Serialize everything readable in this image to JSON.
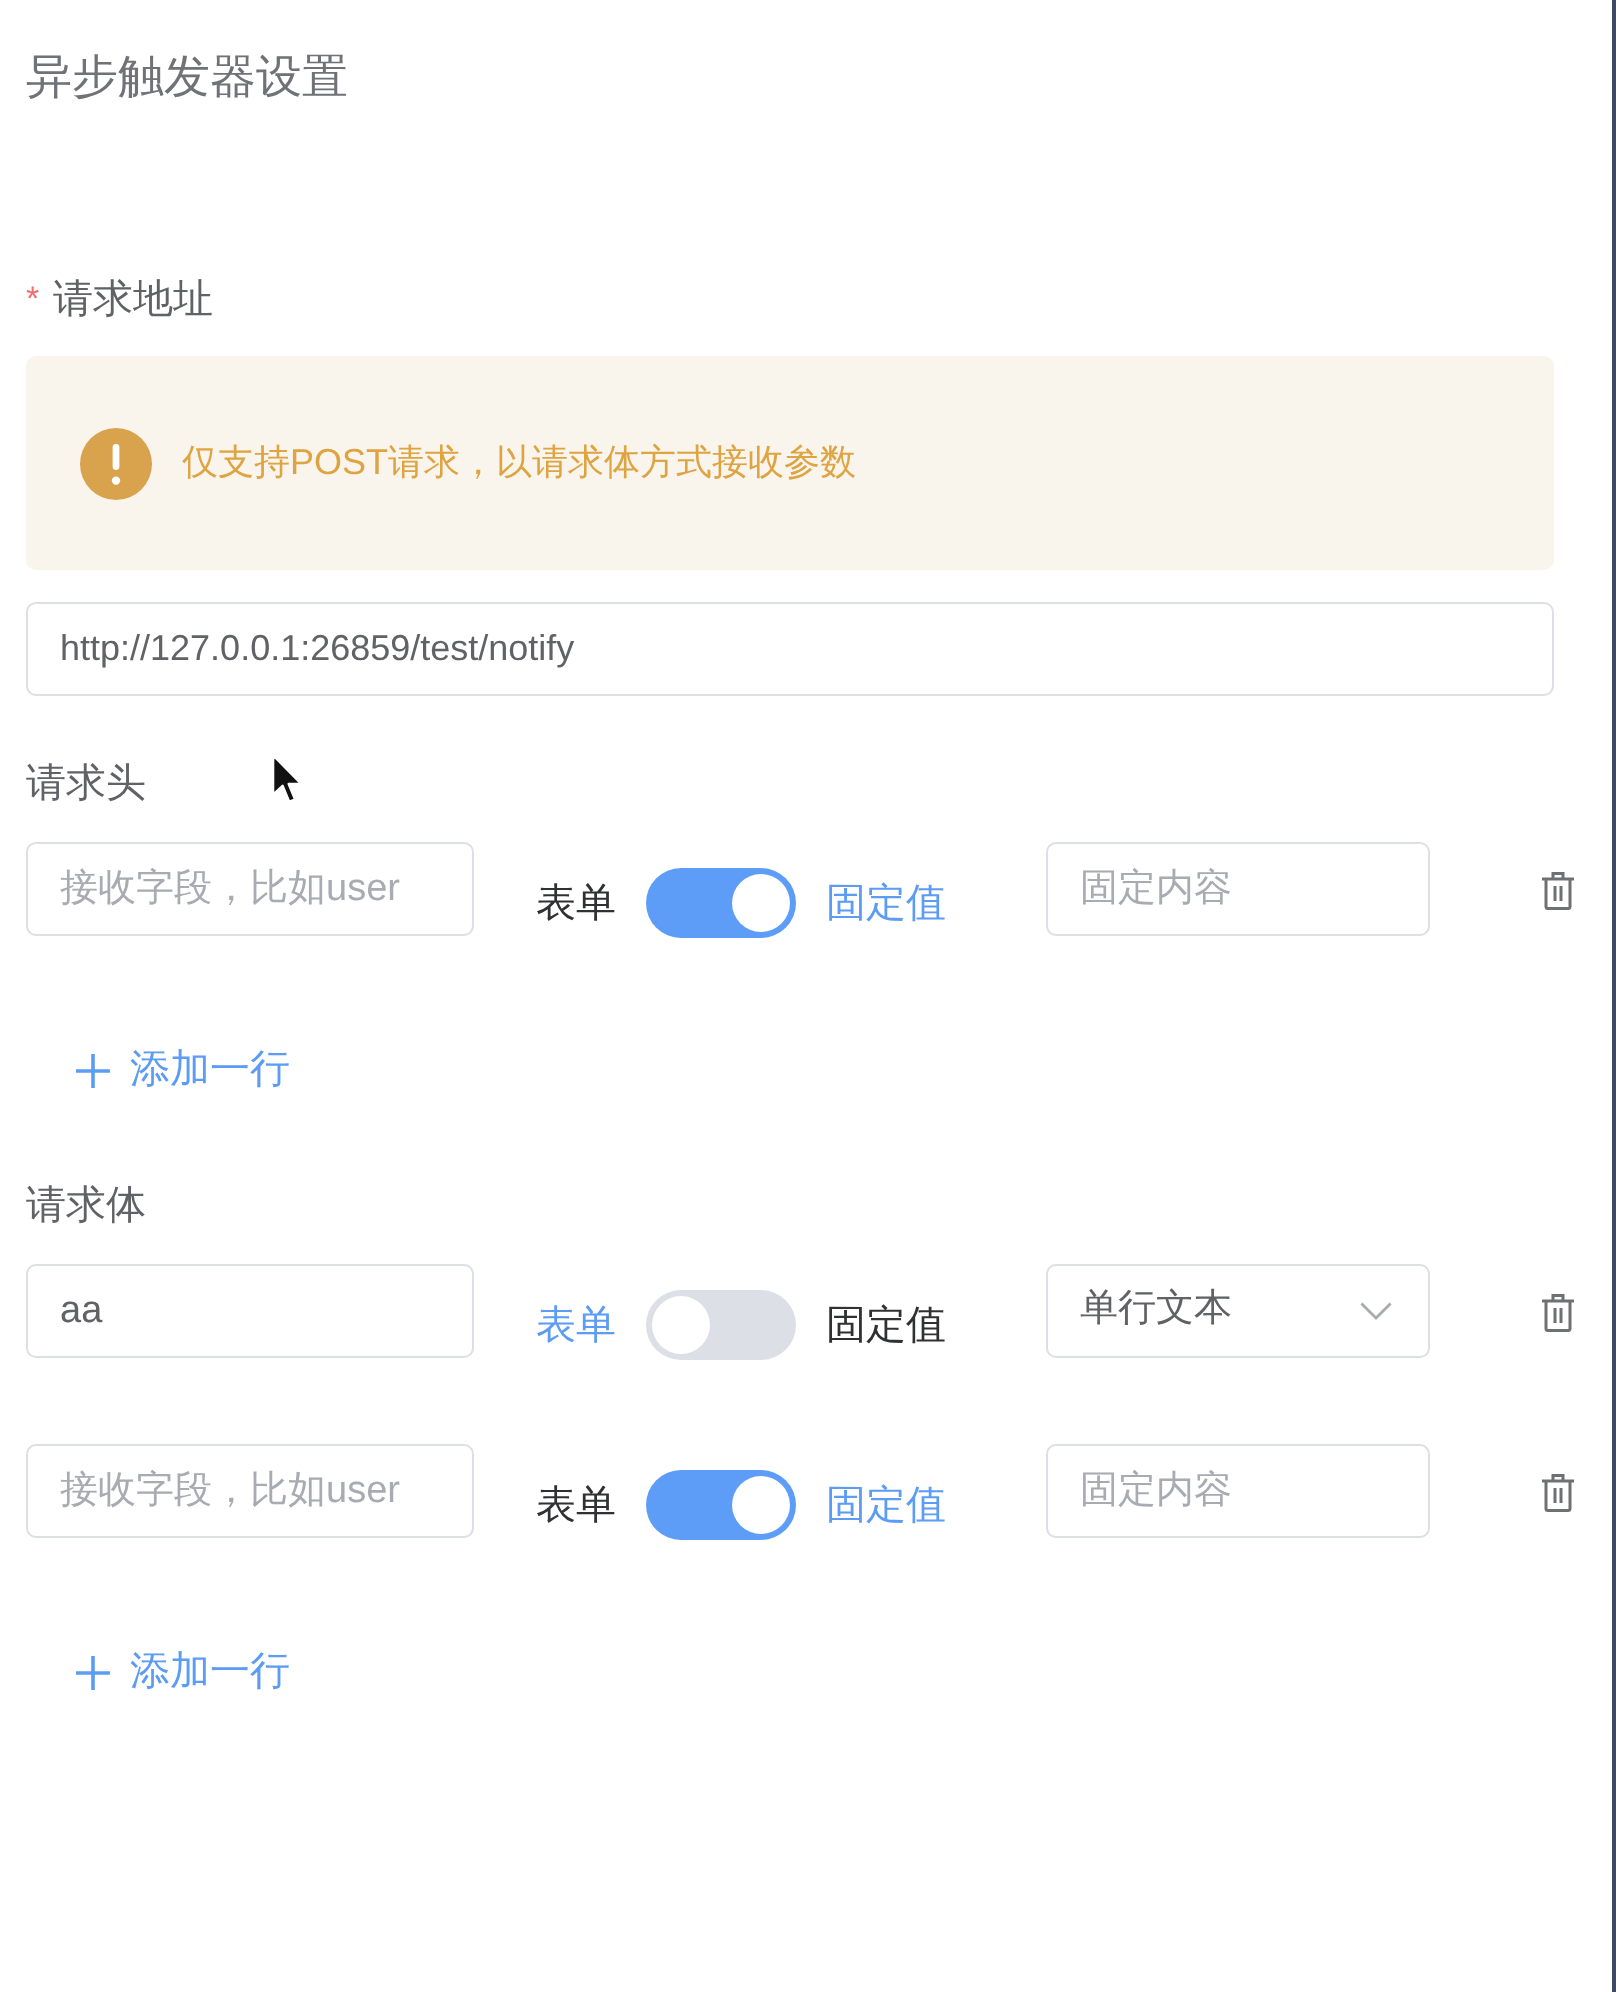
{
  "title": "异步触发器设置",
  "request_url": {
    "required_mark": "*",
    "label": "请求地址",
    "alert": "仅支持POST请求，以请求体方式接收参数",
    "value": "http://127.0.0.1:26859/test/notify"
  },
  "sections": [
    {
      "label": "请求头",
      "rows": [
        {
          "key": {
            "placeholder": "接收字段，比如user"
          },
          "switch": {
            "left_label": "表单",
            "right_label": "固定值",
            "on": true
          },
          "value_field": {
            "kind": "input",
            "placeholder": "固定内容"
          }
        }
      ],
      "add_button": "添加一行"
    },
    {
      "label": "请求体",
      "rows": [
        {
          "key": {
            "value": "aa"
          },
          "switch": {
            "left_label": "表单",
            "right_label": "固定值",
            "on": false
          },
          "value_field": {
            "kind": "select",
            "value": "单行文本"
          }
        },
        {
          "key": {
            "placeholder": "接收字段，比如user"
          },
          "switch": {
            "left_label": "表单",
            "right_label": "固定值",
            "on": true
          },
          "value_field": {
            "kind": "input",
            "placeholder": "固定内容"
          }
        }
      ],
      "add_button": "添加一行"
    }
  ]
}
